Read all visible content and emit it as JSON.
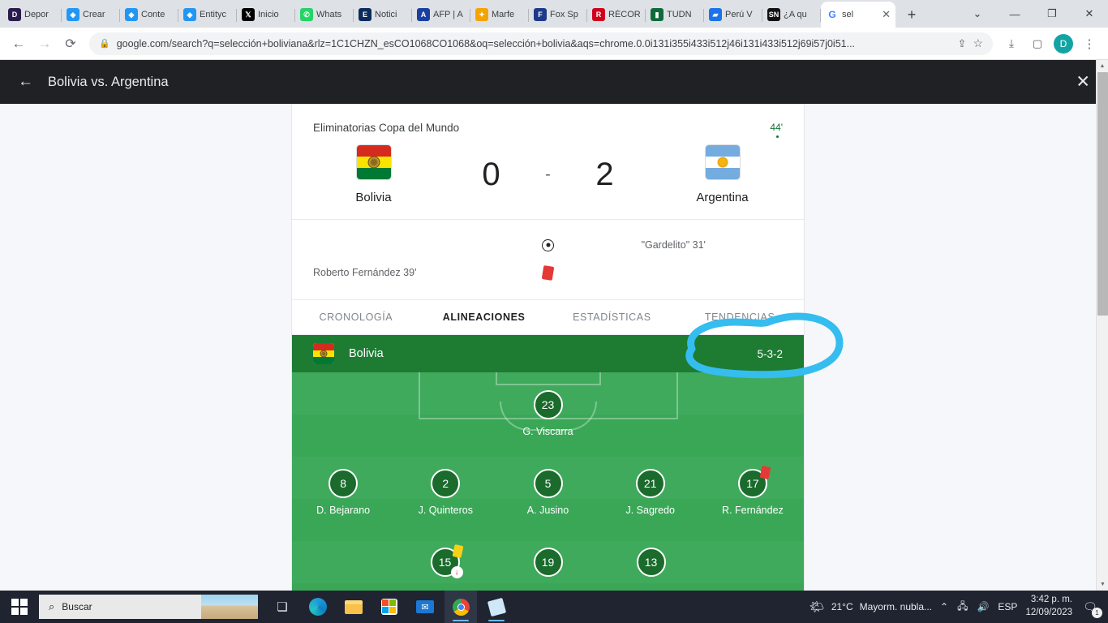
{
  "browser": {
    "tabs": [
      {
        "label": "Depor",
        "fav": "D",
        "color": "#2b1a4d"
      },
      {
        "label": "Crear",
        "fav": "◈",
        "color": "#2196f3"
      },
      {
        "label": "Conte",
        "fav": "◈",
        "color": "#2196f3"
      },
      {
        "label": "Entityc",
        "fav": "◈",
        "color": "#2196f3"
      },
      {
        "label": "Inicio",
        "fav": "𝕏",
        "color": "#000000"
      },
      {
        "label": "Whats",
        "fav": "✆",
        "color": "#25d366"
      },
      {
        "label": "Notici",
        "fav": "E",
        "color": "#0b2b5c"
      },
      {
        "label": "AFP | A",
        "fav": "A",
        "color": "#1a3fa0"
      },
      {
        "label": "Marfe",
        "fav": "✦",
        "color": "#f4a300"
      },
      {
        "label": "Fox Sp",
        "fav": "F",
        "color": "#1d3a8a"
      },
      {
        "label": "RÉCOR",
        "fav": "R",
        "color": "#d0011b"
      },
      {
        "label": "TUDN",
        "fav": "▮",
        "color": "#0f6b3a"
      },
      {
        "label": "Perú V",
        "fav": "▰",
        "color": "#1a73e8"
      },
      {
        "label": "¿A qu",
        "fav": "SN",
        "color": "#111111"
      }
    ],
    "active_tab": {
      "label": "sel",
      "fav": "G",
      "close": "✕"
    },
    "new_tab_label": "+",
    "window_controls": {
      "minimize": "—",
      "maximize": "❐",
      "close": "✕",
      "tab_search": "⌄"
    },
    "nav": {
      "back": "←",
      "forward": "→",
      "reload": "⟳",
      "lock": "🔒",
      "share": "↗",
      "bookmark": "☆",
      "download": "⤓",
      "sidepanel": "▢",
      "menu": "⋮"
    },
    "url": "google.com/search?q=selección+boliviana&rlz=1C1CHZN_esCO1068CO1068&oq=selección+bolivia&aqs=chrome.0.0i131i355i433i512j46i131i433i512j69i57j0i51...",
    "profile_initial": "D"
  },
  "overlay_header": {
    "back_icon": "←",
    "title": "Bolivia vs. Argentina",
    "close_icon": "✕"
  },
  "match": {
    "competition": "Eliminatorias Copa del Mundo",
    "minute": "44'",
    "home": {
      "name": "Bolivia",
      "score": "0"
    },
    "away": {
      "name": "Argentina",
      "score": "2"
    },
    "dash": "-",
    "events": [
      {
        "home": "",
        "away": "\"Gardelito\" 31'",
        "icon": "goal-icon"
      },
      {
        "home": "Roberto Fernández 39'",
        "away": "",
        "icon": "red-card-icon"
      }
    ]
  },
  "tabs_section": {
    "items": [
      {
        "label": "CRONOLOGÍA",
        "active": false
      },
      {
        "label": "ALINEACIONES",
        "active": true
      },
      {
        "label": "ESTADÍSTICAS",
        "active": false
      },
      {
        "label": "TENDENCIAS",
        "active": false
      }
    ]
  },
  "lineup": {
    "team": "Bolivia",
    "formation": "5-3-2",
    "rows": [
      {
        "players": [
          {
            "number": "23",
            "name": "G. Viscarra",
            "card": "",
            "sub": false
          }
        ]
      },
      {
        "players": [
          {
            "number": "8",
            "name": "D. Bejarano",
            "card": "",
            "sub": false
          },
          {
            "number": "2",
            "name": "J. Quinteros",
            "card": "",
            "sub": false
          },
          {
            "number": "5",
            "name": "A. Jusino",
            "card": "",
            "sub": false
          },
          {
            "number": "21",
            "name": "J. Sagredo",
            "card": "",
            "sub": false
          },
          {
            "number": "17",
            "name": "R. Fernández",
            "card": "red",
            "sub": false
          }
        ]
      },
      {
        "players": [
          {
            "number": "15",
            "name": "",
            "card": "yellow",
            "sub": true
          },
          {
            "number": "19",
            "name": "",
            "card": "",
            "sub": false
          },
          {
            "number": "13",
            "name": "",
            "card": "",
            "sub": false
          }
        ]
      }
    ]
  },
  "annotation": {
    "shape": "hand-drawn-ellipse",
    "color": "#35bdf0",
    "targets": "\"Gardelito\" 31'"
  },
  "taskbar": {
    "start_label": "Start",
    "search_placeholder": "Buscar",
    "apps": [
      "task-view",
      "edge",
      "file-explorer",
      "microsoft-store",
      "mail",
      "chrome",
      "sticky-notes"
    ],
    "weather": {
      "temp": "21°C",
      "desc": "Mayorm. nubla..."
    },
    "tray": {
      "chevron": "⌃",
      "network": "🖧",
      "volume": "🔊",
      "language": "ESP"
    },
    "clock": {
      "time": "3:42 p. m.",
      "date": "12/09/2023"
    },
    "notification_count": "1"
  },
  "scrollbar": {
    "up": "▲",
    "down": "▼"
  }
}
